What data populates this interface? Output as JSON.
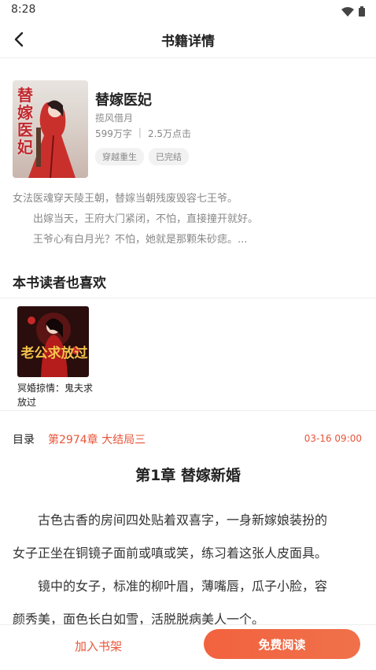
{
  "status_bar": {
    "time": "8:28"
  },
  "header": {
    "title": "书籍详情"
  },
  "book": {
    "title": "替嫁医妃",
    "author": "揽风借月",
    "word_count": "599万字",
    "clicks": "2.5万点击",
    "tags": [
      "穿越重生",
      "已完结"
    ],
    "cover_text": "替嫁医妃"
  },
  "description": [
    "女法医魂穿天陵王朝，替嫁当朝残废毁容七王爷。",
    "　　出嫁当天，王府大门紧闭，不怕，直接撞开就好。",
    "　　王爷心有白月光？不怕，她就是那颗朱砂痣。..."
  ],
  "recommend": {
    "section_title": "本书读者也喜欢",
    "items": [
      {
        "title": "冥婚掠情：鬼夫求放过",
        "cover_text": "老公求放过"
      }
    ]
  },
  "toc": {
    "label": "目录",
    "latest_chapter": "第2974章 大结局三",
    "time": "03-16 09:00"
  },
  "chapter": {
    "title": "第1章 替嫁新婚",
    "paragraph_lines": [
      "　　古色古香的房间四处贴着双喜字，一身新嫁娘装扮的",
      "女子正坐在铜镜子面前或嗔或笑，练习着这张人皮面具。",
      "　　镜中的女子，标准的柳叶眉，薄嘴唇，瓜子小脸，容",
      "颜秀美，面色长白如雪，活脱脱病美人一个。"
    ]
  },
  "bottom": {
    "add_shelf_label": "加入书架",
    "read_label": "免费阅读"
  },
  "colors": {
    "accent": "#e8553a",
    "button_gradient_start": "#f2623f"
  },
  "icons": {
    "back": "chevron-left-icon",
    "wifi": "wifi-icon",
    "battery": "battery-icon"
  }
}
